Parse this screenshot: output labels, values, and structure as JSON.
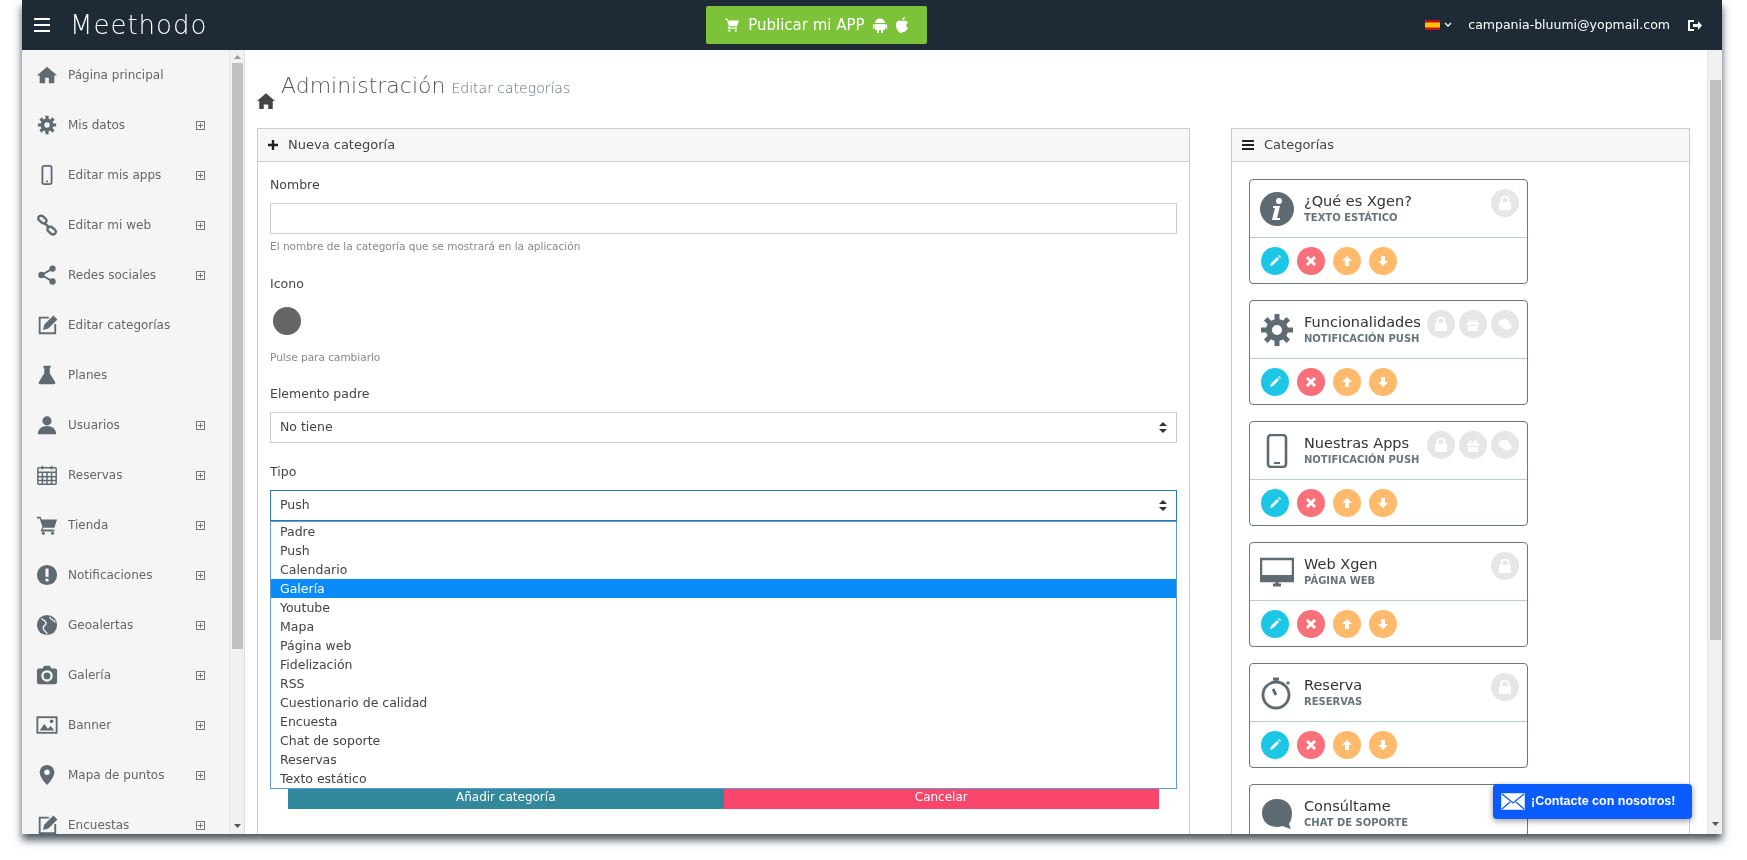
{
  "topbar": {
    "logo": "Meethodo",
    "publish_button": "Publicar mi APP",
    "user_email": "campania-bluumi@yopmail.com"
  },
  "sidebar": {
    "items": [
      {
        "label": "Página principal",
        "expandable": false
      },
      {
        "label": "Mis datos",
        "expandable": true
      },
      {
        "label": "Editar mis apps",
        "expandable": true
      },
      {
        "label": "Editar mi web",
        "expandable": true
      },
      {
        "label": "Redes sociales",
        "expandable": true
      },
      {
        "label": "Editar categorías",
        "expandable": false
      },
      {
        "label": "Planes",
        "expandable": false
      },
      {
        "label": "Usuarios",
        "expandable": true
      },
      {
        "label": "Reservas",
        "expandable": true
      },
      {
        "label": "Tienda",
        "expandable": true
      },
      {
        "label": "Notificaciones",
        "expandable": true
      },
      {
        "label": "Geoalertas",
        "expandable": true
      },
      {
        "label": "Galería",
        "expandable": true
      },
      {
        "label": "Banner",
        "expandable": true
      },
      {
        "label": "Mapa de puntos",
        "expandable": true
      },
      {
        "label": "Encuestas",
        "expandable": true
      }
    ]
  },
  "page_header": {
    "title": "Administración",
    "subtitle": "Editar categorías"
  },
  "new_category": {
    "title": "Nueva categoría",
    "name_label": "Nombre",
    "name_help": "El nombre de la categoría que se mostrará en la aplicación",
    "icon_label": "Icono",
    "icon_help": "Pulse para cambiarlo",
    "parent_label": "Elemento padre",
    "parent_value": "No tiene",
    "type_label": "Tipo",
    "type_value": "Push",
    "type_options": [
      {
        "label": "Padre",
        "selected": false
      },
      {
        "label": "Push",
        "selected": false
      },
      {
        "label": "Calendario",
        "selected": false
      },
      {
        "label": "Galería",
        "selected": true
      },
      {
        "label": "Youtube",
        "selected": false
      },
      {
        "label": "Mapa",
        "selected": false
      },
      {
        "label": "Página web",
        "selected": false
      },
      {
        "label": "Fidelización",
        "selected": false
      },
      {
        "label": "RSS",
        "selected": false
      },
      {
        "label": "Cuestionario de calidad",
        "selected": false
      },
      {
        "label": "Encuesta",
        "selected": false
      },
      {
        "label": "Chat de soporte",
        "selected": false
      },
      {
        "label": "Reservas",
        "selected": false
      },
      {
        "label": "Texto estático",
        "selected": false
      }
    ],
    "add_button": "Añadir categoría",
    "cancel_button": "Cancelar"
  },
  "categories": {
    "title": "Categorías",
    "items": [
      {
        "name": "¿Qué es Xgen?",
        "type": "TEXTO ESTÁTICO",
        "toggles": [
          {
            "kind": "lock"
          }
        ]
      },
      {
        "name": "Funcionalidades",
        "type": "NOTIFICACIÓN PUSH",
        "toggles": [
          {
            "kind": "lock"
          },
          {
            "kind": "gift"
          },
          {
            "kind": "chat"
          }
        ]
      },
      {
        "name": "Nuestras Apps",
        "type": "NOTIFICACIÓN PUSH",
        "toggles": [
          {
            "kind": "lock"
          },
          {
            "kind": "gift"
          },
          {
            "kind": "chat"
          }
        ]
      },
      {
        "name": "Web Xgen",
        "type": "PÁGINA WEB",
        "toggles": [
          {
            "kind": "lock"
          }
        ]
      },
      {
        "name": "Reserva",
        "type": "RESERVAS",
        "toggles": [
          {
            "kind": "lock"
          }
        ]
      },
      {
        "name": "Consúltame",
        "type": "CHAT DE SOPORTE"
      }
    ]
  },
  "contact_button": "¡Contacte con nosotros!"
}
